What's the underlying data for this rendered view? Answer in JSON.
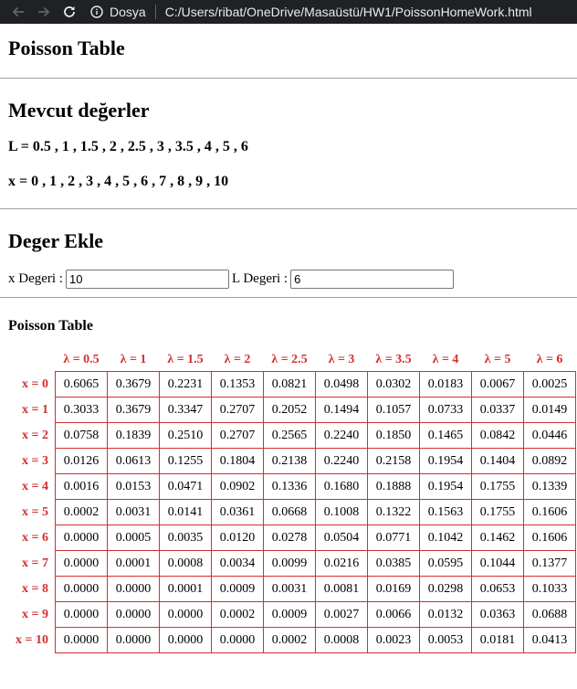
{
  "browser": {
    "site_label": "Dosya",
    "url": "C:/Users/ribat/OneDrive/Masaüstü/HW1/PoissonHomeWork.html"
  },
  "page": {
    "title": "Poisson Table",
    "available": {
      "heading": "Mevcut değerler",
      "l_values": "L = 0.5 , 1 , 1.5 , 2 , 2.5 , 3 , 3.5 , 4 , 5 , 6",
      "x_values": "x = 0 , 1 , 2 , 3 , 4 , 5 , 6 , 7 , 8 , 9 , 10"
    },
    "add": {
      "heading": "Deger Ekle",
      "x_label": "x Degeri :",
      "x_value": "10",
      "l_label": "L Degeri :",
      "l_value": "6"
    },
    "table": {
      "heading": "Poisson Table",
      "columns": [
        "λ = 0.5",
        "λ = 1",
        "λ = 1.5",
        "λ = 2",
        "λ = 2.5",
        "λ = 3",
        "λ = 3.5",
        "λ = 4",
        "λ = 5",
        "λ = 6"
      ],
      "rows": [
        {
          "label": "x = 0",
          "cells": [
            "0.6065",
            "0.3679",
            "0.2231",
            "0.1353",
            "0.0821",
            "0.0498",
            "0.0302",
            "0.0183",
            "0.0067",
            "0.0025"
          ]
        },
        {
          "label": "x = 1",
          "cells": [
            "0.3033",
            "0.3679",
            "0.3347",
            "0.2707",
            "0.2052",
            "0.1494",
            "0.1057",
            "0.0733",
            "0.0337",
            "0.0149"
          ]
        },
        {
          "label": "x = 2",
          "cells": [
            "0.0758",
            "0.1839",
            "0.2510",
            "0.2707",
            "0.2565",
            "0.2240",
            "0.1850",
            "0.1465",
            "0.0842",
            "0.0446"
          ]
        },
        {
          "label": "x = 3",
          "cells": [
            "0.0126",
            "0.0613",
            "0.1255",
            "0.1804",
            "0.2138",
            "0.2240",
            "0.2158",
            "0.1954",
            "0.1404",
            "0.0892"
          ]
        },
        {
          "label": "x = 4",
          "cells": [
            "0.0016",
            "0.0153",
            "0.0471",
            "0.0902",
            "0.1336",
            "0.1680",
            "0.1888",
            "0.1954",
            "0.1755",
            "0.1339"
          ]
        },
        {
          "label": "x = 5",
          "cells": [
            "0.0002",
            "0.0031",
            "0.0141",
            "0.0361",
            "0.0668",
            "0.1008",
            "0.1322",
            "0.1563",
            "0.1755",
            "0.1606"
          ]
        },
        {
          "label": "x = 6",
          "cells": [
            "0.0000",
            "0.0005",
            "0.0035",
            "0.0120",
            "0.0278",
            "0.0504",
            "0.0771",
            "0.1042",
            "0.1462",
            "0.1606"
          ]
        },
        {
          "label": "x = 7",
          "cells": [
            "0.0000",
            "0.0001",
            "0.0008",
            "0.0034",
            "0.0099",
            "0.0216",
            "0.0385",
            "0.0595",
            "0.1044",
            "0.1377"
          ]
        },
        {
          "label": "x = 8",
          "cells": [
            "0.0000",
            "0.0000",
            "0.0001",
            "0.0009",
            "0.0031",
            "0.0081",
            "0.0169",
            "0.0298",
            "0.0653",
            "0.1033"
          ]
        },
        {
          "label": "x = 9",
          "cells": [
            "0.0000",
            "0.0000",
            "0.0000",
            "0.0002",
            "0.0009",
            "0.0027",
            "0.0066",
            "0.0132",
            "0.0363",
            "0.0688"
          ]
        },
        {
          "label": "x = 10",
          "cells": [
            "0.0000",
            "0.0000",
            "0.0000",
            "0.0000",
            "0.0002",
            "0.0008",
            "0.0023",
            "0.0053",
            "0.0181",
            "0.0413"
          ]
        }
      ]
    }
  },
  "icons": [
    "back-icon",
    "forward-icon",
    "reload-icon",
    "info-icon"
  ],
  "colors": {
    "chrome_bg": "#202124",
    "table_accent": "#d32f2f"
  }
}
